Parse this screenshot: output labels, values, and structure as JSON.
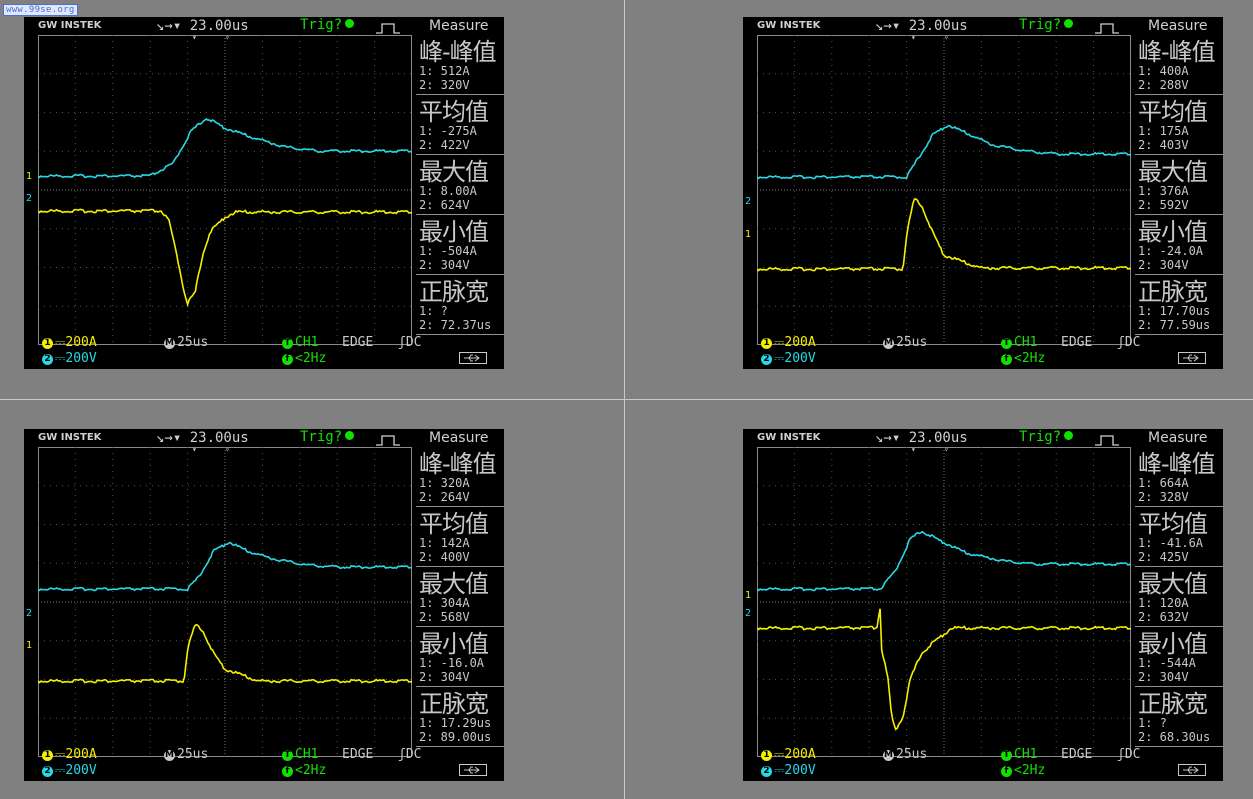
{
  "watermark": "www.99se.org",
  "colors": {
    "ch1": "#f5f000",
    "ch2": "#27d8e6",
    "trig": "#12e000"
  },
  "icons": [
    "edge-trigger-icon",
    "usb-icon",
    "trigger-position-marker-icon"
  ],
  "screens": [
    {
      "brand": "GW INSTEK",
      "timebase": "↘→▾ 23.00us",
      "trig": "Trig?",
      "measure_header": "Measure",
      "measurements": [
        {
          "title": "峰-峰值",
          "v1": "1: 512A",
          "v2": "2: 320V"
        },
        {
          "title": "平均值",
          "v1": "1: -275A",
          "v2": "2: 422V"
        },
        {
          "title": "最大值",
          "v1": "1: 8.00A",
          "v2": "2: 624V"
        },
        {
          "title": "最小值",
          "v1": "1: -504A",
          "v2": "2: 304V"
        },
        {
          "title": "正脉宽",
          "v1": "1:  ?",
          "v2": "2: 72.37us"
        }
      ],
      "footer": {
        "ch1_scale": "200A",
        "ch2_scale": "200V",
        "time": "25us",
        "src": "CH1",
        "mode": "EDGE",
        "coupling": "DC",
        "freq": "<2Hz"
      },
      "markers": {
        "ch1": "1",
        "ch2": "2"
      }
    },
    {
      "brand": "GW INSTEK",
      "timebase": "↘→▾ 23.00us",
      "trig": "Trig?",
      "measure_header": "Measure",
      "measurements": [
        {
          "title": "峰-峰值",
          "v1": "1: 400A",
          "v2": "2: 288V"
        },
        {
          "title": "平均值",
          "v1": "1: 175A",
          "v2": "2: 403V"
        },
        {
          "title": "最大值",
          "v1": "1: 376A",
          "v2": "2: 592V"
        },
        {
          "title": "最小值",
          "v1": "1: -24.0A",
          "v2": "2: 304V"
        },
        {
          "title": "正脉宽",
          "v1": "1: 17.70us",
          "v2": "2: 77.59us"
        }
      ],
      "footer": {
        "ch1_scale": "200A",
        "ch2_scale": "200V",
        "time": "25us",
        "src": "CH1",
        "mode": "EDGE",
        "coupling": "DC",
        "freq": "<2Hz"
      },
      "markers": {
        "ch1": "1",
        "ch2": "2"
      }
    },
    {
      "brand": "GW INSTEK",
      "timebase": "↘→▾ 23.00us",
      "trig": "Trig?",
      "measure_header": "Measure",
      "measurements": [
        {
          "title": "峰-峰值",
          "v1": "1: 320A",
          "v2": "2: 264V"
        },
        {
          "title": "平均值",
          "v1": "1: 142A",
          "v2": "2: 400V"
        },
        {
          "title": "最大值",
          "v1": "1: 304A",
          "v2": "2: 568V"
        },
        {
          "title": "最小值",
          "v1": "1: -16.0A",
          "v2": "2: 304V"
        },
        {
          "title": "正脉宽",
          "v1": "1: 17.29us",
          "v2": "2: 89.00us"
        }
      ],
      "footer": {
        "ch1_scale": "200A",
        "ch2_scale": "200V",
        "time": "25us",
        "src": "CH1",
        "mode": "EDGE",
        "coupling": "DC",
        "freq": "<2Hz"
      },
      "markers": {
        "ch1": "1",
        "ch2": "2"
      }
    },
    {
      "brand": "GW INSTEK",
      "timebase": "↘→▾ 23.00us",
      "trig": "Trig?",
      "measure_header": "Measure",
      "measurements": [
        {
          "title": "峰-峰值",
          "v1": "1: 664A",
          "v2": "2: 328V"
        },
        {
          "title": "平均值",
          "v1": "1: -41.6A",
          "v2": "2: 425V"
        },
        {
          "title": "最大值",
          "v1": "1: 120A",
          "v2": "2: 632V"
        },
        {
          "title": "最小值",
          "v1": "1: -544A",
          "v2": "2: 304V"
        },
        {
          "title": "正脉宽",
          "v1": "1:  ?",
          "v2": "2: 68.30us"
        }
      ],
      "footer": {
        "ch1_scale": "200A",
        "ch2_scale": "200V",
        "time": "25us",
        "src": "CH1",
        "mode": "EDGE",
        "coupling": "DC",
        "freq": "<2Hz"
      },
      "markers": {
        "ch1": "1",
        "ch2": "2"
      }
    }
  ]
}
